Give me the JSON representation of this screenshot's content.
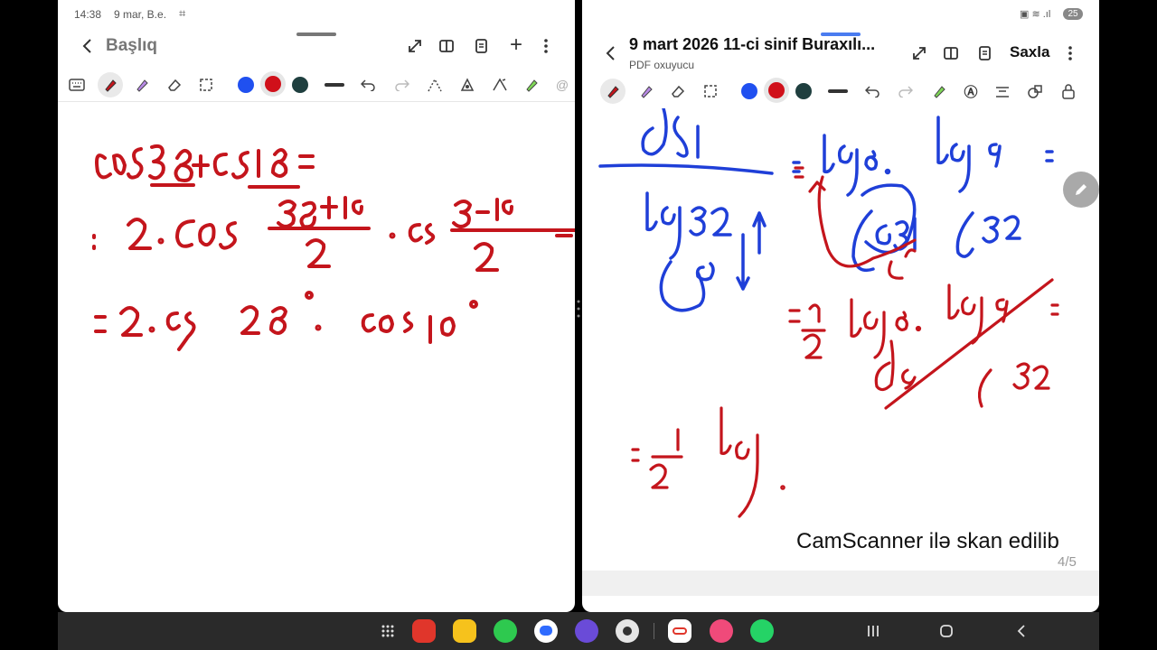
{
  "left": {
    "status": {
      "time": "14:38",
      "date": "9 mar, B.e."
    },
    "header": {
      "title": "Başlıq"
    }
  },
  "right": {
    "header": {
      "title": "9 mart 2026 11-ci sinif Buraxılı...",
      "subtitle": "PDF oxuyucu",
      "save_label": "Saxla"
    },
    "status": {
      "battery": "25"
    },
    "watermark": "CamScanner ilə skan edilib",
    "page_indicator": "4/5"
  },
  "colors": {
    "blue": "#2050f0",
    "red": "#d0101a",
    "teal": "#1f3f3f",
    "ink_red": "#c4151c",
    "ink_blue": "#1f3fd8"
  },
  "icons": [
    "back-arrow-icon",
    "expand-icon",
    "split-view-icon",
    "export-icon",
    "add-icon",
    "more-vert-icon",
    "keyboard-icon",
    "pen-icon",
    "highlighter-icon",
    "eraser-icon",
    "lasso-icon",
    "undo-icon",
    "redo-icon",
    "shape-icon",
    "fill-icon",
    "text-icon",
    "lock-icon",
    "edit-pencil-icon",
    "grid-apps-icon",
    "recent-apps-icon",
    "home-icon",
    "nav-back-icon"
  ]
}
